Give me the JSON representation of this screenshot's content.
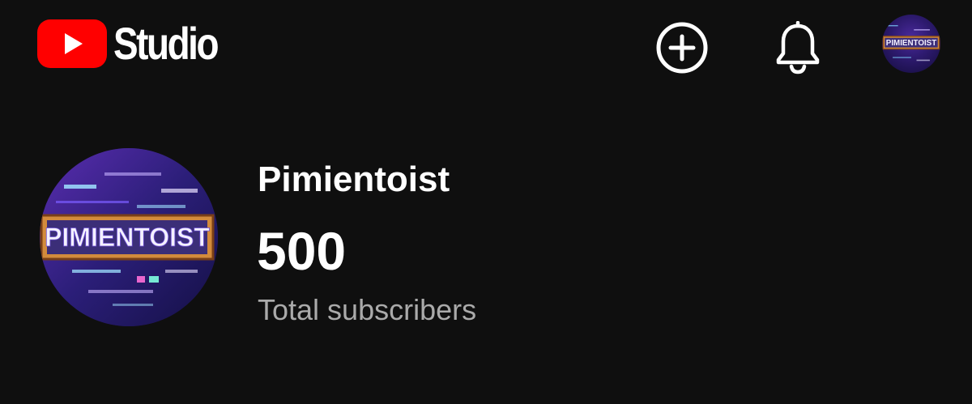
{
  "header": {
    "logo_text": "Studio",
    "brand_color": "#ff0000",
    "icons": {
      "logo": "youtube-play-icon",
      "create": "plus-circle-icon",
      "notifications": "bell-icon",
      "account": "channel-avatar"
    }
  },
  "channel": {
    "name": "Pimientoist",
    "subscriber_count": "500",
    "subscriber_label": "Total subscribers",
    "avatar_text": "PIMIENTOIST"
  },
  "colors": {
    "background": "#0f0f0f",
    "primary_text": "#ffffff",
    "secondary_text": "#aaaaaa"
  }
}
